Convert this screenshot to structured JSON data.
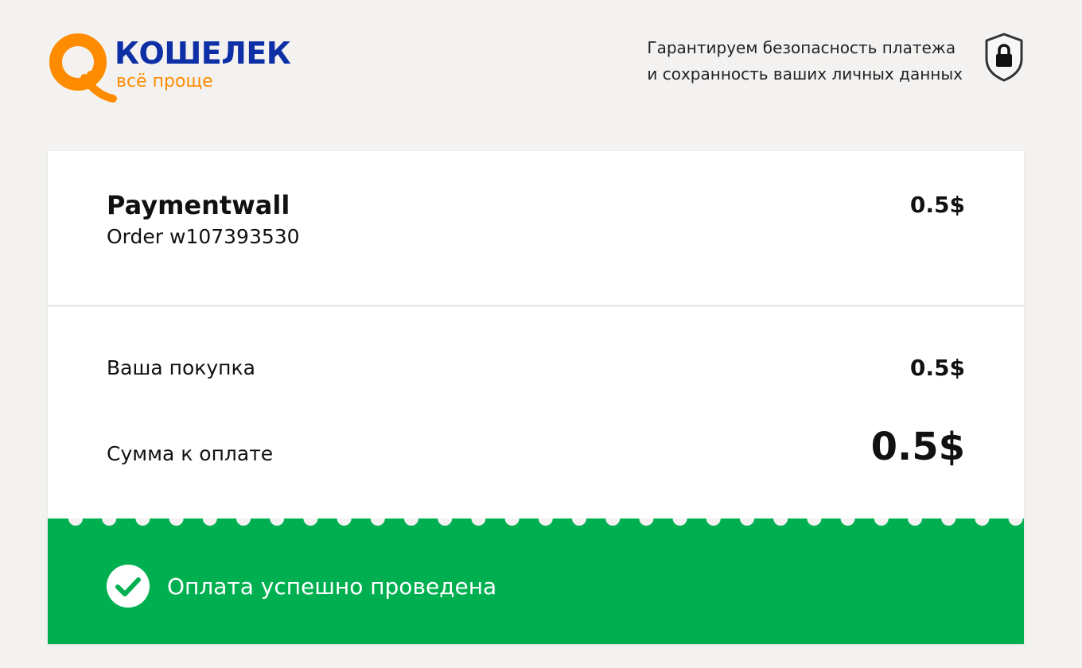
{
  "header": {
    "brand_name": "КОШЕЛЕК",
    "brand_tagline": "всё проще",
    "security_line1": "Гарантируем безопасность платежа",
    "security_line2": "и сохранность ваших личных данных"
  },
  "order": {
    "merchant": "Paymentwall",
    "order_id": "Order w107393530",
    "amount": "0.5$"
  },
  "summary": {
    "purchase_label": "Ваша покупка",
    "purchase_value": "0.5$",
    "total_label": "Сумма к оплате",
    "total_value": "0.5$"
  },
  "status": {
    "message": "Оплата успешно проведена"
  },
  "colors": {
    "brand_blue": "#0e2fa6",
    "brand_orange": "#ff8c00",
    "success_green": "#00b050",
    "background": "#f3f2f1"
  },
  "icons": {
    "logo": "qiwi-logo-icon",
    "security": "shield-lock-icon",
    "status": "check-circle-icon"
  }
}
